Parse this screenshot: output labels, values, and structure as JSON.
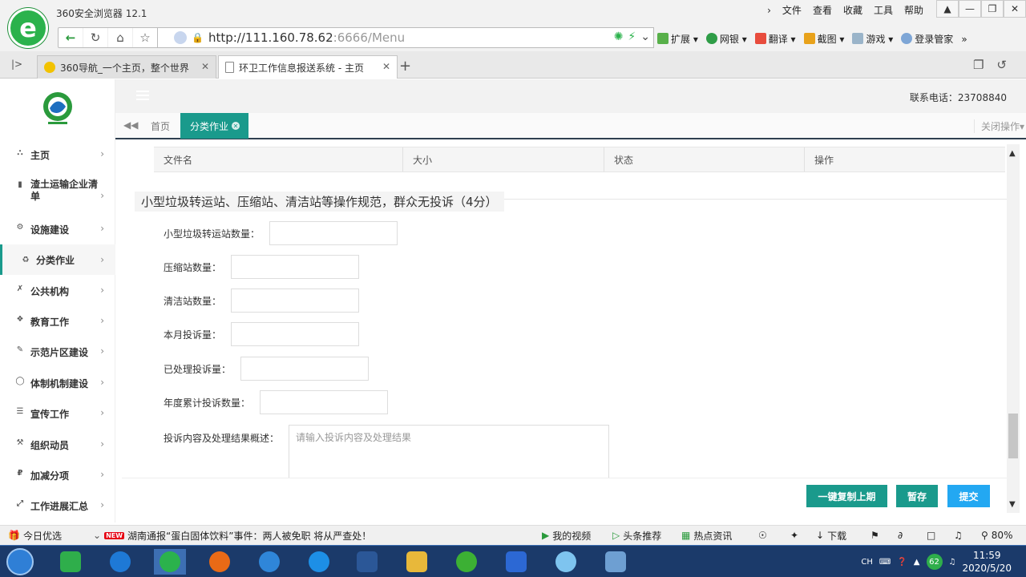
{
  "browser": {
    "app_title": "360安全浏览器 12.1",
    "menu": [
      "文件",
      "查看",
      "收藏",
      "工具",
      "帮助"
    ],
    "url_host": "http://111.160.78.62",
    "url_rest": ":6666/Menu",
    "toolbar": [
      "扩展",
      "网银",
      "翻译",
      "截图",
      "游戏",
      "登录管家"
    ],
    "tabs": [
      {
        "label": "360导航_一个主页，整个世界"
      },
      {
        "label": "环卫工作信息报送系统 - 主页"
      }
    ]
  },
  "app": {
    "phone": "联系电话：23708840",
    "sidebar": [
      {
        "label": "主页"
      },
      {
        "label": "渣土运输企业清单"
      },
      {
        "label": "设施建设"
      },
      {
        "label": "分类作业"
      },
      {
        "label": "公共机构"
      },
      {
        "label": "教育工作"
      },
      {
        "label": "示范片区建设"
      },
      {
        "label": "体制机制建设"
      },
      {
        "label": "宣传工作"
      },
      {
        "label": "组织动员"
      },
      {
        "label": "加减分项"
      },
      {
        "label": "工作进展汇总"
      }
    ],
    "page_tabs": {
      "home": "首页",
      "active": "分类作业",
      "close_ops": "关闭操作"
    },
    "file_table": {
      "headers": [
        "文件名",
        "大小",
        "状态",
        "操作"
      ]
    },
    "section_title": "小型垃圾转运站、压缩站、清洁站等操作规范，群众无投诉（4分）",
    "form": {
      "fields": [
        {
          "label": "小型垃圾转运站数量：",
          "value": ""
        },
        {
          "label": "压缩站数量：",
          "value": ""
        },
        {
          "label": "清洁站数量：",
          "value": ""
        },
        {
          "label": "本月投诉量：",
          "value": ""
        },
        {
          "label": "已处理投诉量：",
          "value": ""
        },
        {
          "label": "年度累计投诉数量：",
          "value": ""
        }
      ],
      "textarea_label": "投诉内容及处理结果概述：",
      "textarea_placeholder": "请输入投诉内容及处理结果"
    },
    "buttons": {
      "copy_last": "一键复制上期",
      "save_draft": "暂存",
      "submit": "提交"
    }
  },
  "status_bar": {
    "today": "今日优选",
    "news": "湖南通报“蛋白固体饮料”事件：两人被免职 将从严查处！",
    "new_badge": "NEW",
    "my_video": "我的视频",
    "headline": "头条推荐",
    "hot_news": "热点资讯",
    "download": "下载",
    "zoom": "80%"
  },
  "taskbar": {
    "time": "11:59",
    "date": "2020/5/20",
    "lang": "CH",
    "tray_badge": "62"
  }
}
